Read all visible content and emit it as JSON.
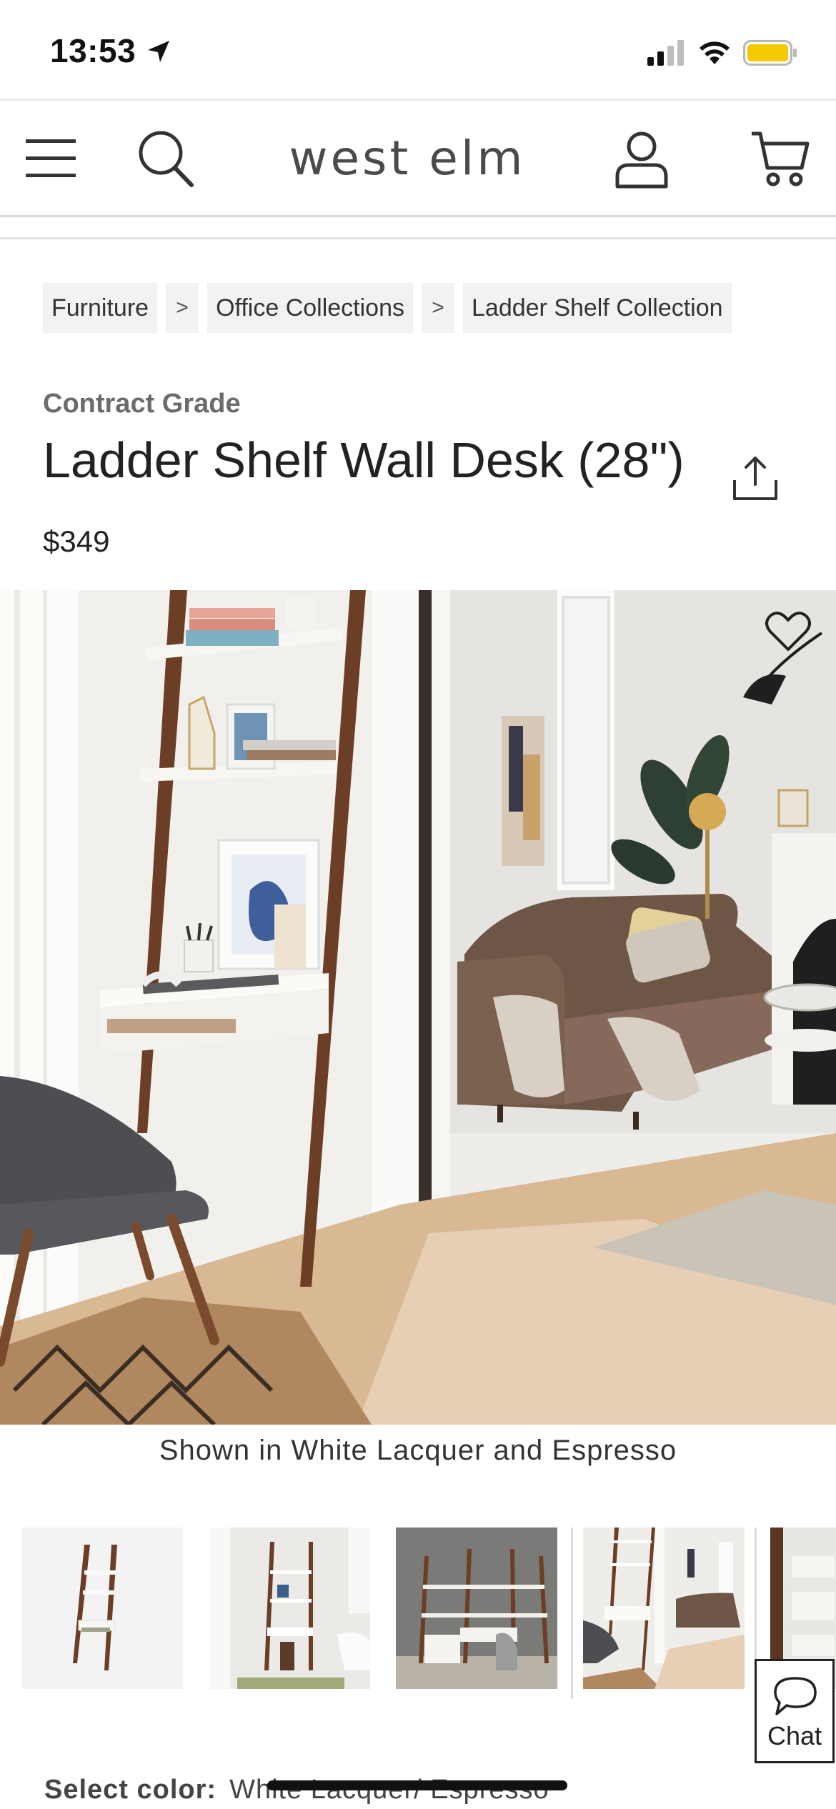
{
  "status_bar": {
    "time": "13:53"
  },
  "header": {
    "logo": "west elm"
  },
  "breadcrumb": {
    "items": [
      "Furniture",
      "Office Collections",
      "Ladder Shelf Collection"
    ],
    "separator": ">"
  },
  "product": {
    "grade": "Contract Grade",
    "title": "Ladder Shelf Wall Desk (28\")",
    "price": "$349",
    "caption": "Shown in White Lacquer and Espresso",
    "thumbnails_count": 5,
    "selected_thumbnail": 4
  },
  "chat": {
    "label": "Chat"
  },
  "color_select": {
    "label": "Select color:",
    "value": "White Lacquer/ Espresso"
  },
  "colors": {
    "battery": "#f6c800",
    "text": "#222222",
    "muted": "#6b6b6b",
    "crumb_bg": "#f2f2f2"
  }
}
